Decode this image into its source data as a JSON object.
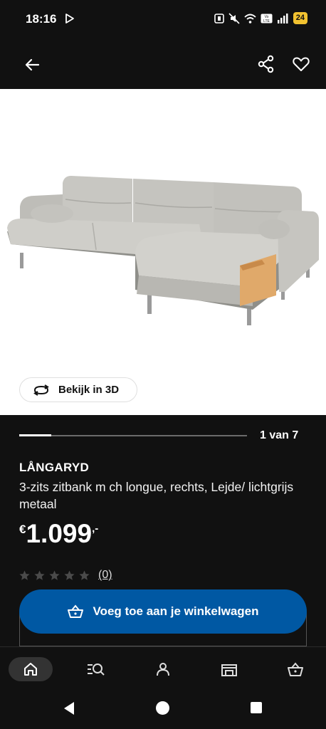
{
  "status_bar": {
    "time": "18:16",
    "battery": "24"
  },
  "header": {
    "back_icon": "arrow-left-icon",
    "share_icon": "share-icon",
    "favorite_icon": "heart-icon"
  },
  "gallery": {
    "view_3d_label": "Bekijk in 3D",
    "counter": "1 van 7",
    "progress": 0.14
  },
  "product": {
    "name": "LÅNGARYD",
    "description": "3-zits zitbank m ch longue, rechts, Lejde/ lichtgrijs metaal",
    "price_currency": "€",
    "price_amount": "1.099",
    "price_decimals": ",-",
    "rating": 0,
    "review_count": "(0)"
  },
  "cart_button": {
    "label": "Voeg toe aan je winkelwagen"
  },
  "bottom_nav": [
    "home-icon",
    "search-list-icon",
    "profile-icon",
    "store-icon",
    "basket-icon"
  ],
  "colors": {
    "primary": "#0058a3",
    "background": "#111111"
  }
}
